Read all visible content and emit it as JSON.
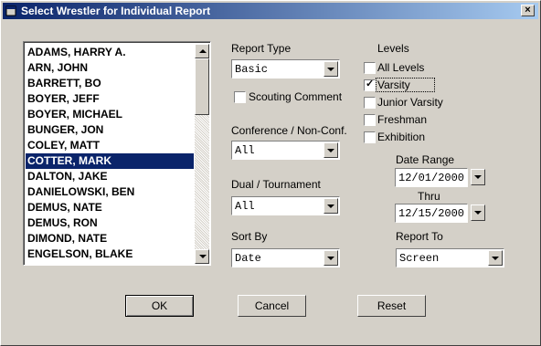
{
  "window": {
    "title": "Select Wrestler for Individual Report",
    "close_label": "×"
  },
  "wrestlers": {
    "items": [
      "ADAMS, HARRY A.",
      "ARN, JOHN",
      "BARRETT, BO",
      "BOYER, JEFF",
      "BOYER, MICHAEL",
      "BUNGER, JON",
      "COLEY, MATT",
      "COTTER, MARK",
      "DALTON, JAKE",
      "DANIELOWSKI, BEN",
      "DEMUS, NATE",
      "DEMUS, RON",
      "DIMOND, NATE",
      "ENGELSON, BLAKE"
    ],
    "selected": "COTTER, MARK"
  },
  "report_type": {
    "label": "Report Type",
    "value": "Basic"
  },
  "scouting": {
    "label": "Scouting Comment",
    "checked": false
  },
  "conference": {
    "label": "Conference / Non-Conf.",
    "value": "All"
  },
  "dual": {
    "label": "Dual / Tournament",
    "value": "All"
  },
  "sort_by": {
    "label": "Sort By",
    "value": "Date"
  },
  "levels": {
    "label": "Levels",
    "options": [
      {
        "label": "All Levels",
        "checked": false
      },
      {
        "label": "Varsity",
        "checked": true
      },
      {
        "label": "Junior Varsity",
        "checked": false
      },
      {
        "label": "Freshman",
        "checked": false
      },
      {
        "label": "Exhibition",
        "checked": false
      }
    ]
  },
  "date_range": {
    "label": "Date Range",
    "from": "12/01/2000",
    "thru_label": "Thru",
    "to": "12/15/2000"
  },
  "report_to": {
    "label": "Report To",
    "value": "Screen"
  },
  "buttons": {
    "ok": "OK",
    "cancel": "Cancel",
    "reset": "Reset"
  },
  "colors": {
    "selection": "#0a246a",
    "face": "#d4d0c8",
    "title_start": "#0a246a",
    "title_end": "#a6caf0"
  }
}
